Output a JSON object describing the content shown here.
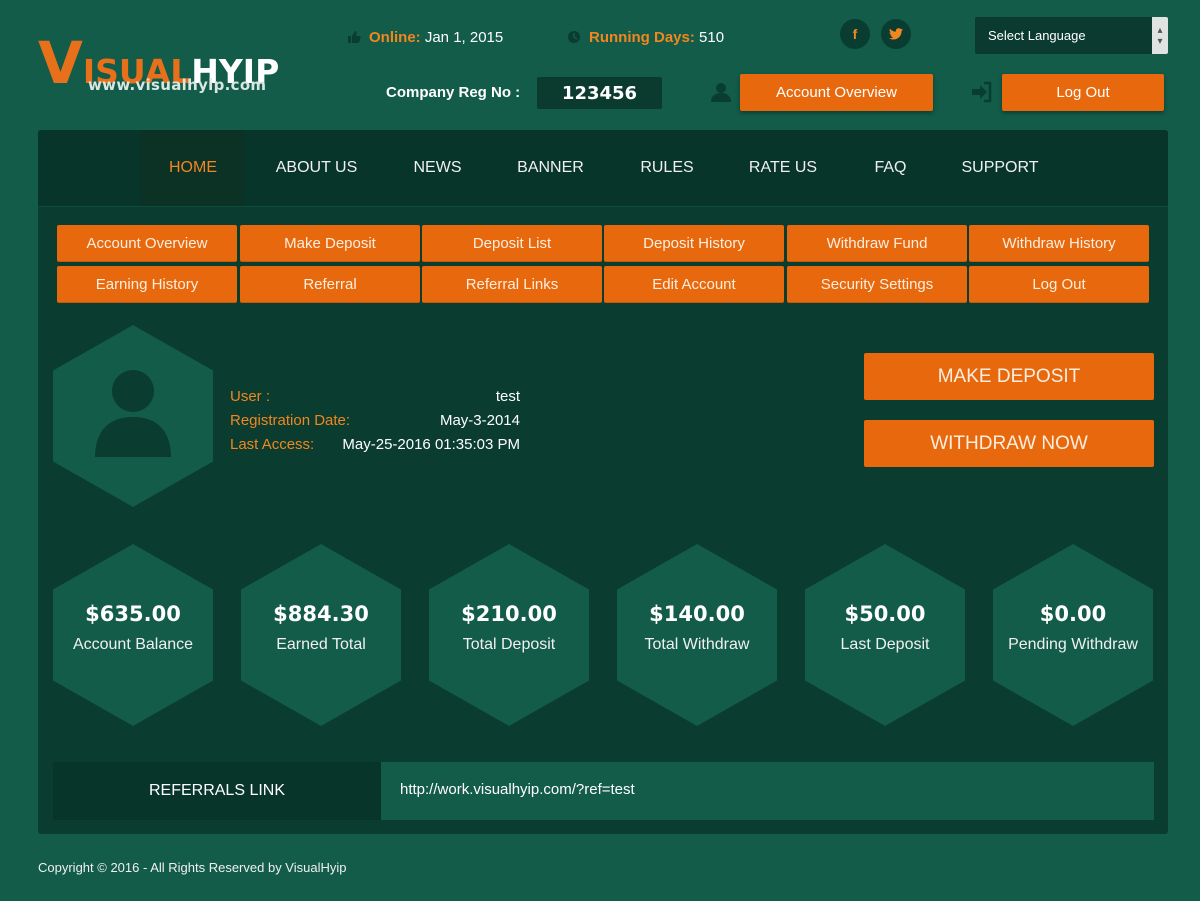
{
  "colors": {
    "background": "#125c49",
    "panel": "#0a3c30",
    "accent": "#e8690d",
    "label_orange": "#f2861f"
  },
  "logo": {
    "initial": "V",
    "word_orange": "ISUAL",
    "word_white": "HYIP",
    "url": "www.visualhyip.com"
  },
  "header": {
    "online_label": "Online:",
    "online_value": "Jan 1, 2015",
    "running_label": "Running Days:",
    "running_value": "510",
    "social": {
      "facebook": "f",
      "twitter": "t"
    },
    "language": "Select Language",
    "company_reg_label": "Company Reg No :",
    "company_reg_value": "123456",
    "account_overview": "Account Overview",
    "logout": "Log Out"
  },
  "nav": {
    "items": [
      {
        "label": "HOME"
      },
      {
        "label": "ABOUT US"
      },
      {
        "label": "NEWS"
      },
      {
        "label": "BANNER"
      },
      {
        "label": "RULES"
      },
      {
        "label": "RATE US"
      },
      {
        "label": "FAQ"
      },
      {
        "label": "SUPPORT"
      }
    ]
  },
  "account_menu": {
    "row1": [
      "Account Overview",
      "Make Deposit",
      "Deposit List",
      "Deposit History",
      "Withdraw Fund",
      "Withdraw History"
    ],
    "row2": [
      "Earning History",
      "Referral",
      "Referral Links",
      "Edit Account",
      "Security Settings",
      "Log Out"
    ]
  },
  "user_info": {
    "user_label": "User :",
    "user_value": "test",
    "reg_label": "Registration Date:",
    "reg_value": "May-3-2014",
    "access_label": "Last Access:",
    "access_value": "May-25-2016 01:35:03 PM"
  },
  "actions": {
    "make_deposit": "MAKE DEPOSIT",
    "withdraw_now": "WITHDRAW NOW"
  },
  "stats": [
    {
      "amount": "$635.00",
      "label": "Account Balance"
    },
    {
      "amount": "$884.30",
      "label": "Earned Total"
    },
    {
      "amount": "$210.00",
      "label": "Total Deposit"
    },
    {
      "amount": "$140.00",
      "label": "Total Withdraw"
    },
    {
      "amount": "$50.00",
      "label": "Last Deposit"
    },
    {
      "amount": "$0.00",
      "label": "Pending Withdraw"
    }
  ],
  "referral": {
    "label": "REFERRALS LINK",
    "url": "http://work.visualhyip.com/?ref=test"
  },
  "footer": {
    "copyright": "Copyright © 2016 - All Rights Reserved by VisualHyip"
  }
}
